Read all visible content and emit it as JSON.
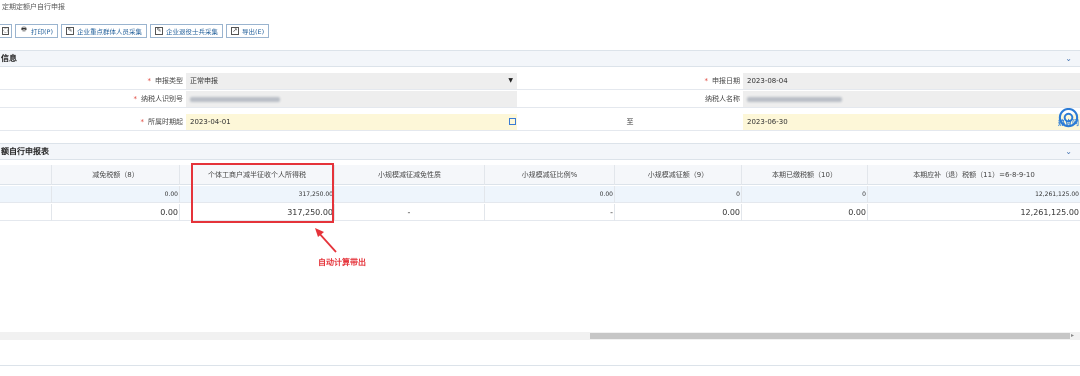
{
  "breadcrumb": "定期定额户自行申报",
  "toolbar": {
    "first_label": "",
    "print_label": "打印(P)",
    "collect1_label": "企业重点群体人员采集",
    "collect2_label": "企业退役士兵采集",
    "export_label": "导出(E)"
  },
  "info_panel": {
    "title": "信息",
    "row1": {
      "label1": "申报类型",
      "value1": "正常申报",
      "label2": "申报日期",
      "value2": "2023-08-04"
    },
    "row2": {
      "label1": "纳税人识别号",
      "label2": "纳税人名称"
    },
    "row3": {
      "label1": "所属时期起",
      "value1": "2023-04-01",
      "mid": "至",
      "value2": "2023-06-30"
    }
  },
  "grid_panel": {
    "title": "额自行申报表",
    "headers": [
      "减免税额（8）",
      "个体工商户减半征收个人所得税",
      "小规模减征减免性质",
      "小规模减征比例%",
      "小规模减征额（9）",
      "本期已缴税额（10）",
      "本期应补（退）税额（11）=6-8-9-10"
    ],
    "row1": [
      "0.00",
      "317,250.00",
      "",
      "0.00",
      "0",
      "0",
      "12,261,125.00"
    ],
    "row2": [
      "0.00",
      "317,250.00",
      "-",
      "-",
      "0.00",
      "0.00",
      "12,261,125.00"
    ]
  },
  "annotation": "自动计算带出",
  "right_widget": {
    "label": "热点问"
  },
  "bottom_panel": {
    "title": ""
  },
  "colors": {
    "accent": "#1f5d99",
    "highlight": "#e5333a",
    "required": "#e0453a",
    "yellow_field": "#fdf7d8"
  }
}
